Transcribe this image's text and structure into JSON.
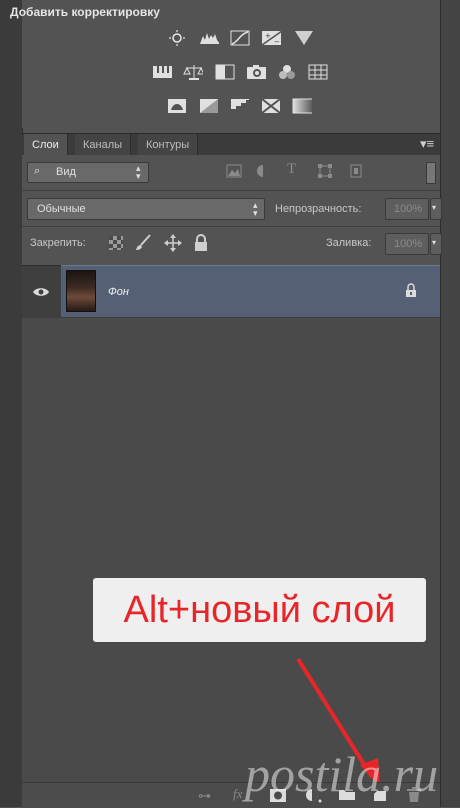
{
  "adjustments": {
    "title": "Добавить корректировку",
    "row1": [
      "brightness-icon",
      "levels-icon",
      "curves-icon",
      "exposure-icon",
      "gradient-map-triangle-icon"
    ],
    "row2": [
      "vibrance-icon",
      "color-balance-icon",
      "black-white-icon",
      "photo-filter-icon",
      "channel-mixer-icon",
      "color-lookup-icon"
    ],
    "row3": [
      "invert-icon",
      "posterize-icon",
      "threshold-icon",
      "selective-color-icon",
      "gradient-map-icon"
    ]
  },
  "tabs": [
    "Слои",
    "Каналы",
    "Контуры"
  ],
  "filter": {
    "label": "Вид"
  },
  "blend": {
    "mode": "Обычные",
    "opacity_label": "Непрозрачность:",
    "opacity_value": "100%"
  },
  "lock": {
    "label": "Закрепить:",
    "fill_label": "Заливка:",
    "fill_value": "100%"
  },
  "layer": {
    "name": "Фон"
  },
  "callout": "Alt+новый слой",
  "watermark": "postila.ru"
}
